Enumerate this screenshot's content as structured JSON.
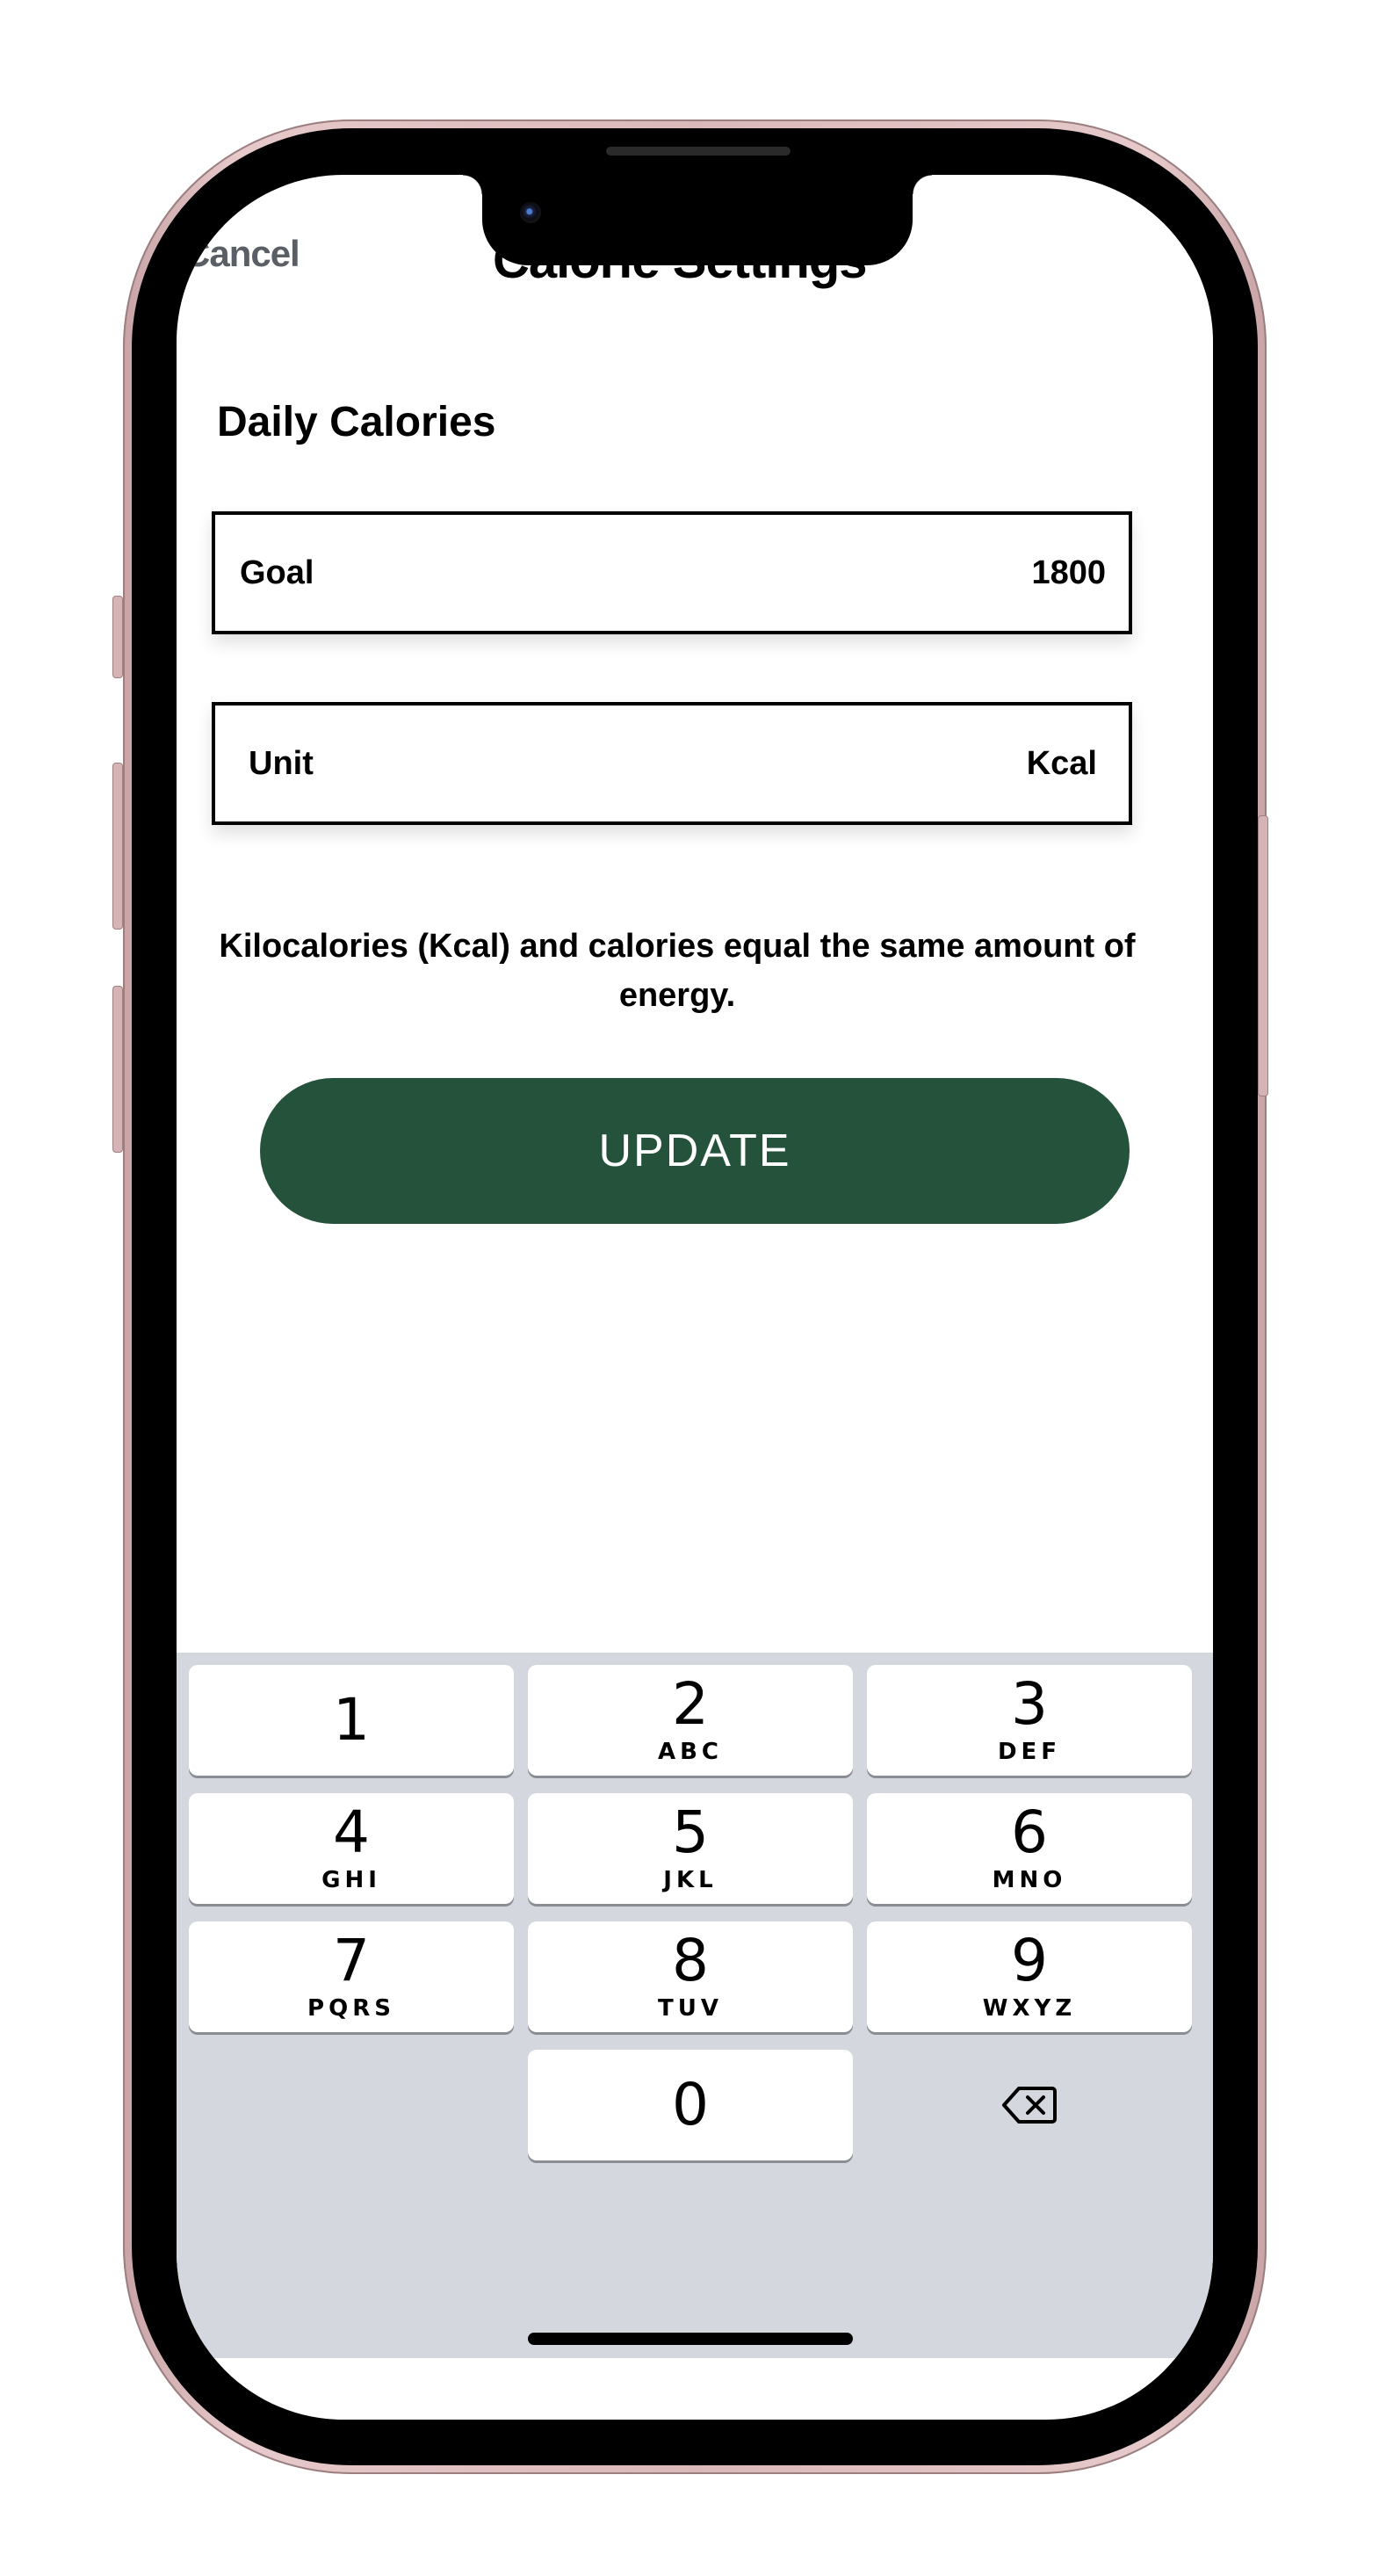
{
  "header": {
    "cancel_label": "Cancel",
    "title": "Calorie Settings"
  },
  "daily_calories": {
    "section_title": "Daily Calories",
    "goal": {
      "label": "Goal",
      "value": "1800"
    },
    "unit": {
      "label": "Unit",
      "value": "Kcal"
    },
    "info_text": "Kilocalories (Kcal) and calories equal the same amount of energy."
  },
  "update_button": {
    "label": "UPDATE",
    "color": "#24523a"
  },
  "keypad": {
    "keys": [
      {
        "digit": "1",
        "letters": ""
      },
      {
        "digit": "2",
        "letters": "ABC"
      },
      {
        "digit": "3",
        "letters": "DEF"
      },
      {
        "digit": "4",
        "letters": "GHI"
      },
      {
        "digit": "5",
        "letters": "JKL"
      },
      {
        "digit": "6",
        "letters": "MNO"
      },
      {
        "digit": "7",
        "letters": "PQRS"
      },
      {
        "digit": "8",
        "letters": "TUV"
      },
      {
        "digit": "9",
        "letters": "WXYZ"
      },
      {
        "digit": "0",
        "letters": ""
      }
    ],
    "delete_icon": "backspace-icon"
  }
}
